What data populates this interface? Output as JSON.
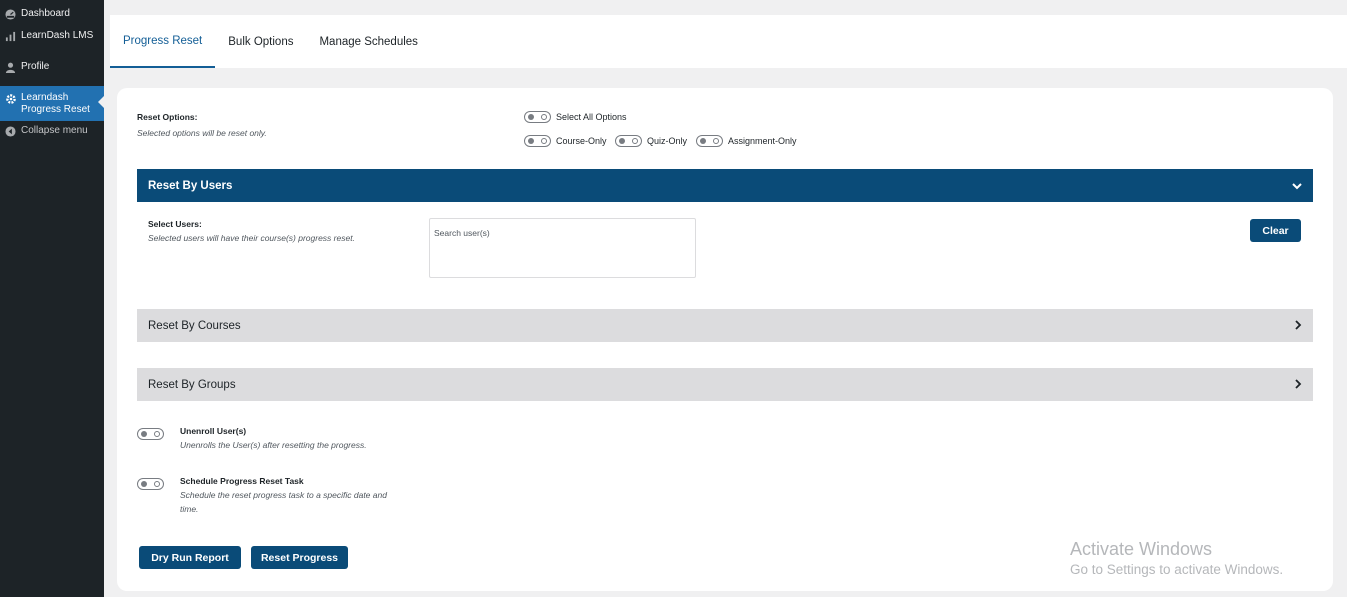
{
  "sidebar": {
    "items": [
      {
        "label": "Dashboard",
        "icon": "dashboard-icon"
      },
      {
        "label": "LearnDash LMS",
        "icon": "chart-bars-icon"
      },
      {
        "label": "Profile",
        "icon": "user-icon"
      },
      {
        "label": "Learndash Progress Reset",
        "label_line1": "Learndash",
        "label_line2": "Progress Reset",
        "icon": "gear-icon",
        "active": true
      },
      {
        "label": "Collapse menu",
        "icon": "collapse-arrow-icon"
      }
    ],
    "background": "#1d2327",
    "active_color": "#2271b1"
  },
  "tabs": [
    {
      "label": "Progress Reset",
      "active": true
    },
    {
      "label": "Bulk Options"
    },
    {
      "label": "Manage Schedules"
    }
  ],
  "reset_options": {
    "title": "Reset Options:",
    "description": "Selected options will be reset only.",
    "select_all": "Select All Options",
    "options": [
      "Course-Only",
      "Quiz-Only",
      "Assignment-Only"
    ]
  },
  "sections": {
    "users": {
      "title": "Reset By Users",
      "expanded": true,
      "select_title": "Select Users:",
      "select_description": "Selected users will have their course(s) progress reset.",
      "search_placeholder": "Search user(s)",
      "clear_label": "Clear"
    },
    "courses": {
      "title": "Reset By Courses",
      "expanded": false
    },
    "groups": {
      "title": "Reset By Groups",
      "expanded": false
    }
  },
  "extras": {
    "unenroll": {
      "title": "Unenroll User(s)",
      "description": "Unenrolls the User(s) after resetting the progress."
    },
    "schedule": {
      "title": "Schedule Progress Reset Task",
      "description": "Schedule the reset progress task to a specific date and time."
    }
  },
  "actions": {
    "dry_run": "Dry Run Report",
    "reset": "Reset Progress"
  },
  "watermark": {
    "title": "Activate Windows",
    "subtitle": "Go to Settings to activate Windows."
  },
  "colors": {
    "primary": "#0a4b78",
    "tab_active": "#135e96",
    "accordion_collapsed": "#dcdcde"
  }
}
